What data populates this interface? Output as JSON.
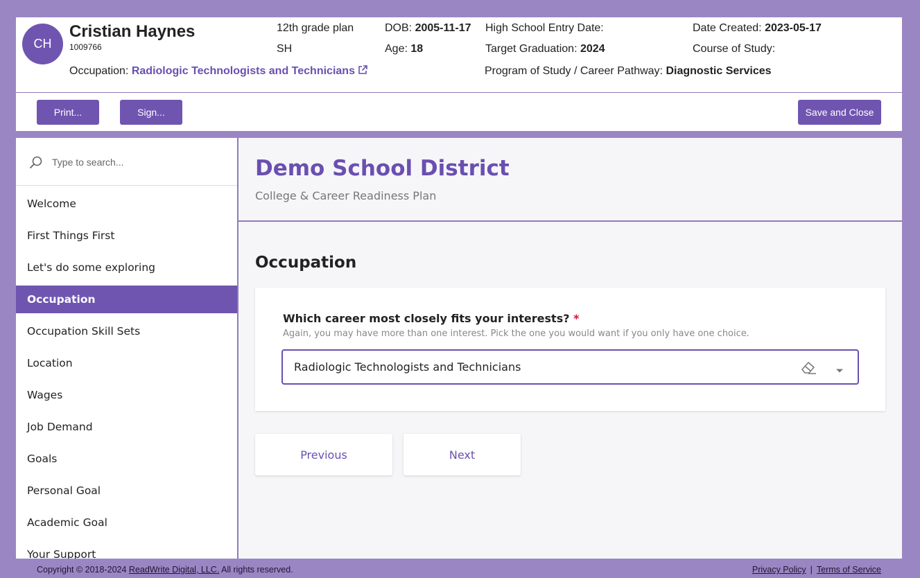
{
  "student": {
    "initials": "CH",
    "name": "Cristian Haynes",
    "id": "1009766",
    "occupation_label": "Occupation:",
    "occupation_value": "Radiologic Technologists and Technicians",
    "plan": "12th grade plan",
    "school": "SH",
    "dob_label": "DOB:",
    "dob": "2005-11-17",
    "age_label": "Age:",
    "age": "18",
    "entry_label": "High School Entry Date:",
    "grad_label": "Target Graduation:",
    "grad": "2024",
    "pathway_label": "Program of Study / Career Pathway:",
    "pathway": "Diagnostic Services",
    "created_label": "Date Created:",
    "created": "2023-05-17",
    "course_label": "Course of Study:"
  },
  "toolbar": {
    "print_label": "Print...",
    "sign_label": "Sign...",
    "save_close_label": "Save and Close"
  },
  "search": {
    "placeholder": "Type to search..."
  },
  "sidebar": {
    "items": [
      {
        "label": "Welcome"
      },
      {
        "label": "First Things First"
      },
      {
        "label": "Let's do some exploring"
      },
      {
        "label": "Occupation",
        "active": true
      },
      {
        "label": "Occupation Skill Sets"
      },
      {
        "label": "Location"
      },
      {
        "label": "Wages"
      },
      {
        "label": "Job Demand"
      },
      {
        "label": "Goals"
      },
      {
        "label": "Personal Goal"
      },
      {
        "label": "Academic Goal"
      },
      {
        "label": "Your Support"
      }
    ]
  },
  "main": {
    "district": "Demo School District",
    "plan_name": "College & Career Readiness Plan",
    "section_title": "Occupation",
    "question": "Which career most closely fits your interests?",
    "required_mark": "*",
    "help": "Again, you may have more than one interest. Pick the one you would want if you only have one choice.",
    "selected_value": "Radiologic Technologists and Technicians",
    "previous_label": "Previous",
    "next_label": "Next"
  },
  "footer": {
    "copyright_prefix": "Copyright © 2018-2024",
    "company": "ReadWrite Digital, LLC.",
    "rights": "All rights reserved.",
    "privacy": "Privacy Policy",
    "separator": "|",
    "terms": "Terms of Service"
  },
  "colors": {
    "brand": "#6f55b0",
    "frame": "#9b86c4",
    "required": "#d0143c"
  }
}
